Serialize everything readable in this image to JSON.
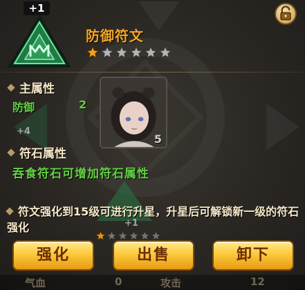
{
  "rune": {
    "level_badge": "+1",
    "name": "防御符文",
    "stars_total": 6,
    "stars_filled": 1,
    "icon": "green-triangle-rune-icon",
    "colors": {
      "title": "#f5a623",
      "stat_green": "#62d145",
      "icon_green": "#1f7a45"
    }
  },
  "main_attr": {
    "heading": "主属性",
    "stat_name": "防御",
    "stat_value": "2"
  },
  "rune_attr": {
    "heading": "符石属性",
    "description": "吞食符石可增加符石属性"
  },
  "portrait": {
    "count": "5"
  },
  "note": "符文强化到15级可进行升星，升星后可解锁新一级的符石强化",
  "buttons": {
    "enhance": "强化",
    "sell": "出售",
    "unload": "卸下"
  },
  "background": {
    "ghost_left_label": "+4",
    "ghost_bottom_label": "+1",
    "bottom_bar": {
      "label_left": "气血",
      "value_left": "0",
      "label_mid": "攻击",
      "value_right": "12"
    }
  }
}
